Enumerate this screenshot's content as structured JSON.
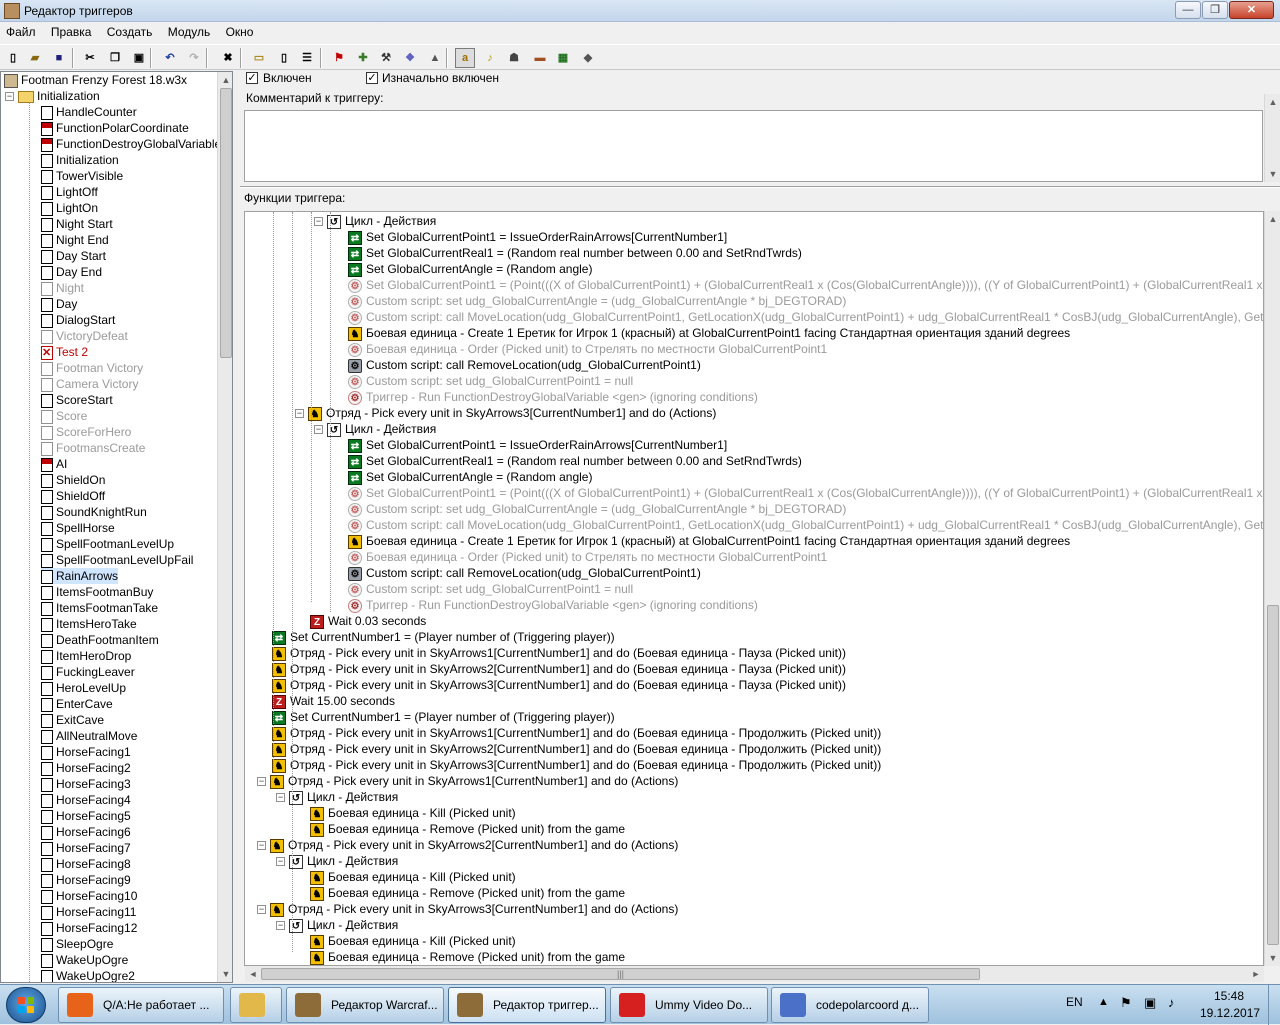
{
  "window": {
    "title": "Редактор триггеров"
  },
  "menu": [
    "Файл",
    "Правка",
    "Создать",
    "Модуль",
    "Окно"
  ],
  "toolbar_icons": [
    "new-icon",
    "open-icon",
    "save-icon",
    "cut-icon",
    "copy-icon",
    "paste-icon",
    "undo-icon",
    "redo-icon",
    "delete-icon",
    "category-icon",
    "trigger-icon",
    "comment-icon",
    "terrain-editor-icon",
    "unit-editor-icon",
    "doodad-editor-icon",
    "trigger-editor-icon",
    "sound-editor-icon",
    "object-editor-icon",
    "campaign-editor-icon",
    "ai-editor-icon",
    "object-manager-icon",
    "import-manager-icon",
    "test-map-icon"
  ],
  "tree": {
    "map_file": "Footman Frenzy Forest 18.w3x",
    "category": "Initialization",
    "triggers": [
      {
        "name": "HandleCounter",
        "state": "normal"
      },
      {
        "name": "FunctionPolarCoordinate",
        "state": "red"
      },
      {
        "name": "FunctionDestroyGlobalVariable",
        "state": "red"
      },
      {
        "name": "Initialization",
        "state": "normal"
      },
      {
        "name": "TowerVisible",
        "state": "normal"
      },
      {
        "name": "LightOff",
        "state": "normal"
      },
      {
        "name": "LightOn",
        "state": "normal"
      },
      {
        "name": "Night Start",
        "state": "normal"
      },
      {
        "name": "Night End",
        "state": "normal"
      },
      {
        "name": "Day Start",
        "state": "normal"
      },
      {
        "name": "Day End",
        "state": "normal"
      },
      {
        "name": "Night",
        "state": "disabled"
      },
      {
        "name": "Day",
        "state": "normal"
      },
      {
        "name": "DialogStart",
        "state": "normal"
      },
      {
        "name": "VictoryDefeat",
        "state": "disabled"
      },
      {
        "name": "Test 2",
        "state": "error"
      },
      {
        "name": "Footman Victory",
        "state": "disabled"
      },
      {
        "name": "Camera Victory",
        "state": "disabled"
      },
      {
        "name": "ScoreStart",
        "state": "normal"
      },
      {
        "name": "Score",
        "state": "disabled"
      },
      {
        "name": "ScoreForHero",
        "state": "disabled"
      },
      {
        "name": "FootmansCreate",
        "state": "disabled"
      },
      {
        "name": "AI",
        "state": "red"
      },
      {
        "name": "ShieldOn",
        "state": "normal"
      },
      {
        "name": "ShieldOff",
        "state": "normal"
      },
      {
        "name": "SoundKnightRun",
        "state": "normal"
      },
      {
        "name": "SpellHorse",
        "state": "normal"
      },
      {
        "name": "SpellFootmanLevelUp",
        "state": "normal"
      },
      {
        "name": "SpellFootmanLevelUpFail",
        "state": "normal"
      },
      {
        "name": "RainArrows",
        "state": "selected"
      },
      {
        "name": "ItemsFootmanBuy",
        "state": "normal"
      },
      {
        "name": "ItemsFootmanTake",
        "state": "normal"
      },
      {
        "name": "ItemsHeroTake",
        "state": "normal"
      },
      {
        "name": "DeathFootmanItem",
        "state": "normal"
      },
      {
        "name": "ItemHeroDrop",
        "state": "normal"
      },
      {
        "name": "FuckingLeaver",
        "state": "normal"
      },
      {
        "name": "HeroLevelUp",
        "state": "normal"
      },
      {
        "name": "EnterCave",
        "state": "normal"
      },
      {
        "name": "ExitCave",
        "state": "normal"
      },
      {
        "name": "AllNeutralMove",
        "state": "normal"
      },
      {
        "name": "HorseFacing1",
        "state": "normal"
      },
      {
        "name": "HorseFacing2",
        "state": "normal"
      },
      {
        "name": "HorseFacing3",
        "state": "normal"
      },
      {
        "name": "HorseFacing4",
        "state": "normal"
      },
      {
        "name": "HorseFacing5",
        "state": "normal"
      },
      {
        "name": "HorseFacing6",
        "state": "normal"
      },
      {
        "name": "HorseFacing7",
        "state": "normal"
      },
      {
        "name": "HorseFacing8",
        "state": "normal"
      },
      {
        "name": "HorseFacing9",
        "state": "normal"
      },
      {
        "name": "HorseFacing10",
        "state": "normal"
      },
      {
        "name": "HorseFacing11",
        "state": "normal"
      },
      {
        "name": "HorseFacing12",
        "state": "normal"
      },
      {
        "name": "SleepOgre",
        "state": "normal"
      },
      {
        "name": "WakeUpOgre",
        "state": "normal"
      },
      {
        "name": "WakeUpOgre2",
        "state": "normal"
      }
    ]
  },
  "props": {
    "enabled_label": "Включен",
    "enabled_checked": true,
    "initially_on_label": "Изначально включен",
    "initially_on_checked": true,
    "comment_label": "Комментарий к триггеру:",
    "comment_value": "",
    "functions_label": "Функции триггера:"
  },
  "functions": [
    {
      "indent": 4,
      "icon": "loop",
      "toggle": "-",
      "grey": false,
      "text": "Цикл - Действия"
    },
    {
      "indent": 5,
      "icon": "set",
      "grey": false,
      "text": "Set GlobalCurrentPoint1 = IssueOrderRainArrows[CurrentNumber1]"
    },
    {
      "indent": 5,
      "icon": "set",
      "grey": false,
      "text": "Set GlobalCurrentReal1 = (Random real number between 0.00 and SetRndTwrds)"
    },
    {
      "indent": 5,
      "icon": "set",
      "grey": false,
      "text": "Set GlobalCurrentAngle = (Random angle)"
    },
    {
      "indent": 5,
      "icon": "cs",
      "grey": true,
      "text": "Set GlobalCurrentPoint1 = (Point(((X of GlobalCurrentPoint1) + (GlobalCurrentReal1 x (Cos(GlobalCurrentAngle)))), ((Y of GlobalCurrentPoint1) + (GlobalCurrentReal1 x (Sin(GlobalCurrentAngle"
    },
    {
      "indent": 5,
      "icon": "cs",
      "grey": true,
      "text": "Custom script:   set udg_GlobalCurrentAngle = (udg_GlobalCurrentAngle * bj_DEGTORAD)"
    },
    {
      "indent": 5,
      "icon": "cs",
      "grey": true,
      "text": "Custom script:   call MoveLocation(udg_GlobalCurrentPoint1, GetLocationX(udg_GlobalCurrentPoint1) + udg_GlobalCurrentReal1 * CosBJ(udg_GlobalCurrentAngle), GetLocationY(udg_Glol"
    },
    {
      "indent": 5,
      "icon": "unit",
      "grey": false,
      "text": "Боевая единица - Create 1 Еретик for Игрок 1 (красный) at GlobalCurrentPoint1 facing Стандартная ориентация зданий degrees"
    },
    {
      "indent": 5,
      "icon": "cs",
      "grey": true,
      "text": "Боевая единица - Order (Picked unit) to Стрелять по местности GlobalCurrentPoint1"
    },
    {
      "indent": 5,
      "icon": "csb",
      "grey": false,
      "text": "Custom script:   call RemoveLocation(udg_GlobalCurrentPoint1)"
    },
    {
      "indent": 5,
      "icon": "cs",
      "grey": true,
      "text": "Custom script:   set udg_GlobalCurrentPoint1 = null"
    },
    {
      "indent": 5,
      "icon": "trig",
      "grey": true,
      "text": "Триггер - Run FunctionDestroyGlobalVariable <gen> (ignoring conditions)"
    },
    {
      "indent": 3,
      "icon": "unit",
      "toggle": "-",
      "grey": false,
      "text": "Отряд - Pick every unit in SkyArrows3[CurrentNumber1] and do (Actions)"
    },
    {
      "indent": 4,
      "icon": "loop",
      "toggle": "-",
      "grey": false,
      "text": "Цикл - Действия"
    },
    {
      "indent": 5,
      "icon": "set",
      "grey": false,
      "text": "Set GlobalCurrentPoint1 = IssueOrderRainArrows[CurrentNumber1]"
    },
    {
      "indent": 5,
      "icon": "set",
      "grey": false,
      "text": "Set GlobalCurrentReal1 = (Random real number between 0.00 and SetRndTwrds)"
    },
    {
      "indent": 5,
      "icon": "set",
      "grey": false,
      "text": "Set GlobalCurrentAngle = (Random angle)"
    },
    {
      "indent": 5,
      "icon": "cs",
      "grey": true,
      "text": "Set GlobalCurrentPoint1 = (Point(((X of GlobalCurrentPoint1) + (GlobalCurrentReal1 x (Cos(GlobalCurrentAngle)))), ((Y of GlobalCurrentPoint1) + (GlobalCurrentReal1 x (Sin(GlobalCurrentAngle"
    },
    {
      "indent": 5,
      "icon": "cs",
      "grey": true,
      "text": "Custom script:   set udg_GlobalCurrentAngle = (udg_GlobalCurrentAngle * bj_DEGTORAD)"
    },
    {
      "indent": 5,
      "icon": "cs",
      "grey": true,
      "text": "Custom script:   call MoveLocation(udg_GlobalCurrentPoint1, GetLocationX(udg_GlobalCurrentPoint1) + udg_GlobalCurrentReal1 * CosBJ(udg_GlobalCurrentAngle), GetLocationY(udg_Glol"
    },
    {
      "indent": 5,
      "icon": "unit",
      "grey": false,
      "text": "Боевая единица - Create 1 Еретик for Игрок 1 (красный) at GlobalCurrentPoint1 facing Стандартная ориентация зданий degrees"
    },
    {
      "indent": 5,
      "icon": "cs",
      "grey": true,
      "text": "Боевая единица - Order (Picked unit) to Стрелять по местности GlobalCurrentPoint1"
    },
    {
      "indent": 5,
      "icon": "csb",
      "grey": false,
      "text": "Custom script:   call RemoveLocation(udg_GlobalCurrentPoint1)"
    },
    {
      "indent": 5,
      "icon": "cs",
      "grey": true,
      "text": "Custom script:   set udg_GlobalCurrentPoint1 = null"
    },
    {
      "indent": 5,
      "icon": "trig",
      "grey": true,
      "text": "Триггер - Run FunctionDestroyGlobalVariable <gen> (ignoring conditions)"
    },
    {
      "indent": 3,
      "icon": "wait",
      "grey": false,
      "text": "Wait 0.03 seconds"
    },
    {
      "indent": 1,
      "icon": "set",
      "grey": false,
      "text": "Set CurrentNumber1 = (Player number of (Triggering player))"
    },
    {
      "indent": 1,
      "icon": "unit",
      "grey": false,
      "text": "Отряд - Pick every unit in SkyArrows1[CurrentNumber1] and do (Боевая единица - Пауза (Picked unit))"
    },
    {
      "indent": 1,
      "icon": "unit",
      "grey": false,
      "text": "Отряд - Pick every unit in SkyArrows2[CurrentNumber1] and do (Боевая единица - Пауза (Picked unit))"
    },
    {
      "indent": 1,
      "icon": "unit",
      "grey": false,
      "text": "Отряд - Pick every unit in SkyArrows3[CurrentNumber1] and do (Боевая единица - Пауза (Picked unit))"
    },
    {
      "indent": 1,
      "icon": "wait",
      "grey": false,
      "text": "Wait 15.00 seconds"
    },
    {
      "indent": 1,
      "icon": "set",
      "grey": false,
      "text": "Set CurrentNumber1 = (Player number of (Triggering player))"
    },
    {
      "indent": 1,
      "icon": "unit",
      "grey": false,
      "text": "Отряд - Pick every unit in SkyArrows1[CurrentNumber1] and do (Боевая единица - Продолжить (Picked unit))"
    },
    {
      "indent": 1,
      "icon": "unit",
      "grey": false,
      "text": "Отряд - Pick every unit in SkyArrows2[CurrentNumber1] and do (Боевая единица - Продолжить (Picked unit))"
    },
    {
      "indent": 1,
      "icon": "unit",
      "grey": false,
      "text": "Отряд - Pick every unit in SkyArrows3[CurrentNumber1] and do (Боевая единица - Продолжить (Picked unit))"
    },
    {
      "indent": 1,
      "icon": "unit",
      "toggle": "-",
      "grey": false,
      "text": "Отряд - Pick every unit in SkyArrows1[CurrentNumber1] and do (Actions)"
    },
    {
      "indent": 2,
      "icon": "loop",
      "toggle": "-",
      "grey": false,
      "text": "Цикл - Действия"
    },
    {
      "indent": 3,
      "icon": "unit",
      "grey": false,
      "text": "Боевая единица - Kill (Picked unit)"
    },
    {
      "indent": 3,
      "icon": "unit",
      "grey": false,
      "text": "Боевая единица - Remove (Picked unit) from the game"
    },
    {
      "indent": 1,
      "icon": "unit",
      "toggle": "-",
      "grey": false,
      "text": "Отряд - Pick every unit in SkyArrows2[CurrentNumber1] and do (Actions)"
    },
    {
      "indent": 2,
      "icon": "loop",
      "toggle": "-",
      "grey": false,
      "text": "Цикл - Действия"
    },
    {
      "indent": 3,
      "icon": "unit",
      "grey": false,
      "text": "Боевая единица - Kill (Picked unit)"
    },
    {
      "indent": 3,
      "icon": "unit",
      "grey": false,
      "text": "Боевая единица - Remove (Picked unit) from the game"
    },
    {
      "indent": 1,
      "icon": "unit",
      "toggle": "-",
      "grey": false,
      "text": "Отряд - Pick every unit in SkyArrows3[CurrentNumber1] and do (Actions)"
    },
    {
      "indent": 2,
      "icon": "loop",
      "toggle": "-",
      "grey": false,
      "text": "Цикл - Действия"
    },
    {
      "indent": 3,
      "icon": "unit",
      "grey": false,
      "text": "Боевая единица - Kill (Picked unit)"
    },
    {
      "indent": 3,
      "icon": "unit",
      "grey": false,
      "text": "Боевая единица - Remove (Picked unit) from the game"
    }
  ],
  "taskbar": {
    "items": [
      {
        "label": "Q/A:Не работает ...",
        "icon": "firefox-icon",
        "color": "#e8631a"
      },
      {
        "label": "",
        "icon": "explorer-icon",
        "color": "#e3b84a"
      },
      {
        "label": "Редактор Warcraf...",
        "icon": "worldedit-icon",
        "color": "#8d6c3a"
      },
      {
        "label": "Редактор триггер...",
        "icon": "worldedit-icon",
        "color": "#8d6c3a",
        "active": true
      },
      {
        "label": "Ummy Video Do...",
        "icon": "ummy-icon",
        "color": "#d62020"
      },
      {
        "label": "codepolarcoord д...",
        "icon": "paint-icon",
        "color": "#4a70c8"
      }
    ],
    "lang": "EN",
    "time": "15:48",
    "date": "19.12.2017"
  },
  "colors": {
    "selection": "#d0e6ff",
    "taskbar": "#a8c6e0"
  }
}
